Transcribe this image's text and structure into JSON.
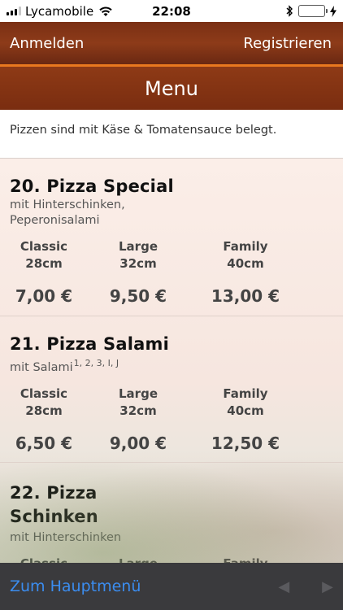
{
  "status_bar": {
    "carrier": "Lycamobile",
    "time": "22:08"
  },
  "nav": {
    "login_label": "Anmelden",
    "register_label": "Registrieren"
  },
  "title": "Menu",
  "info_text": "Pizzen sind mit Käse & Tomatensauce belegt.",
  "items": [
    {
      "name": "20. Pizza Special",
      "description": "mit Hinterschinken, Peperonisalami",
      "allergens": "",
      "sizes": [
        {
          "name": "Classic",
          "size": "28cm",
          "price": "7,00 €"
        },
        {
          "name": "Large",
          "size": "32cm",
          "price": "9,50 €"
        },
        {
          "name": "Family",
          "size": "40cm",
          "price": "13,00 €"
        }
      ]
    },
    {
      "name": "21. Pizza Salami",
      "description": "mit Salami",
      "allergens": "1, 2, 3, I, J",
      "sizes": [
        {
          "name": "Classic",
          "size": "28cm",
          "price": "6,50 €"
        },
        {
          "name": "Large",
          "size": "32cm",
          "price": "9,00 €"
        },
        {
          "name": "Family",
          "size": "40cm",
          "price": "12,50 €"
        }
      ]
    },
    {
      "name": "22. Pizza Schinken",
      "description": "mit Hinterschinken",
      "allergens": "",
      "sizes": [
        {
          "name": "Classic",
          "size": "",
          "price": ""
        },
        {
          "name": "Large",
          "size": "",
          "price": ""
        },
        {
          "name": "Family",
          "size": "",
          "price": ""
        }
      ]
    }
  ],
  "toolbar": {
    "back_label": "Zum Hauptmenü",
    "prev_icon": "◀",
    "next_icon": "▶"
  },
  "colors": {
    "header": "#7a2f14",
    "accent": "#e8781f",
    "link": "#3b8df0",
    "toolbar": "#343438"
  }
}
